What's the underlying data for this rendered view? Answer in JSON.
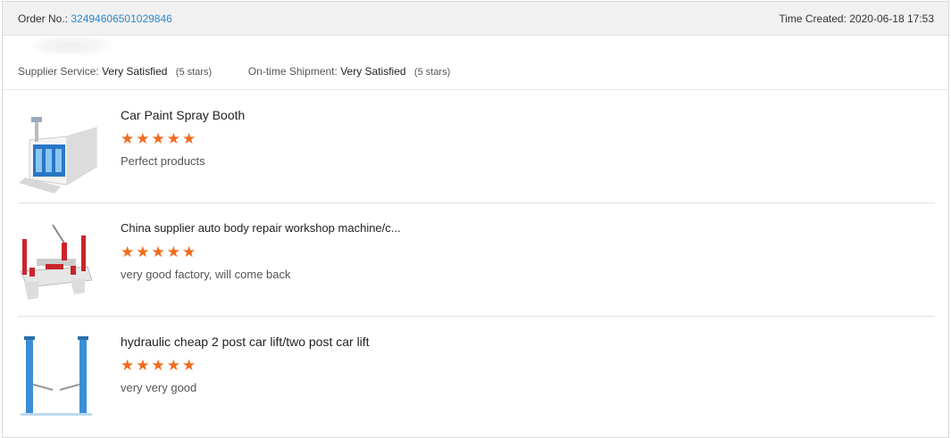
{
  "order": {
    "number_label": "Order No.:",
    "number": "3249460650102984​6",
    "time_label": "Time Created:",
    "time": "2020-06-18 17:53"
  },
  "ratings": {
    "supplier_label": "Supplier Service:",
    "supplier_value": "Very Satisfied",
    "supplier_stars": "(5 stars)",
    "shipment_label": "On-time Shipment:",
    "shipment_value": "Very Satisfied",
    "shipment_stars": "(5 stars)"
  },
  "items": [
    {
      "title": "Car Paint Spray Booth",
      "rating": 5,
      "comment": "Perfect products",
      "image": "spray-booth"
    },
    {
      "title": "China supplier auto body repair workshop machine/c...",
      "rating": 5,
      "comment": "very good factory, will come back",
      "image": "frame-machine"
    },
    {
      "title": "hydraulic cheap 2 post car lift/two post car lift",
      "rating": 5,
      "comment": "very very good",
      "image": "two-post-lift"
    }
  ],
  "colors": {
    "star": "#f26b1d",
    "order_number": "#2e87c8",
    "header_bg": "#f1f1f1"
  }
}
